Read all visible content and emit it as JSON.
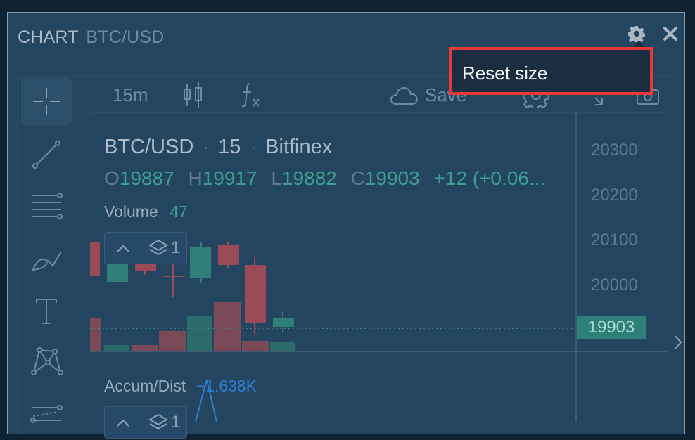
{
  "panel": {
    "title_main": "CHART",
    "title_symbol": "BTC/USD",
    "settings_icon": "gear-icon",
    "close_icon": "close-icon"
  },
  "top_toolbar": {
    "interval": "15m",
    "save_label": "Save"
  },
  "left_tools": [
    {
      "name": "crosshair-icon",
      "active": true
    },
    {
      "name": "trend-line-icon"
    },
    {
      "name": "fib-lines-icon"
    },
    {
      "name": "brush-icon"
    },
    {
      "name": "text-icon"
    },
    {
      "name": "pattern-icon"
    },
    {
      "name": "measure-icon"
    }
  ],
  "legend": {
    "symbol": "BTC/USD",
    "interval": "15",
    "exchange": "Bitfinex",
    "sep": "·",
    "o_key": "O",
    "o_val": "19887",
    "h_key": "H",
    "h_val": "19917",
    "l_key": "L",
    "l_val": "19882",
    "c_key": "C",
    "c_val": "19903",
    "change": "+12 (+0.06..."
  },
  "volume": {
    "name": "Volume",
    "value": "47",
    "layers": "1"
  },
  "accum": {
    "name": "Accum/Dist",
    "value": "−1.638K",
    "layers": "1"
  },
  "price_axis": {
    "labels": [
      "20300",
      "20200",
      "20100",
      "20000"
    ],
    "current": "19903"
  },
  "dropdown": {
    "item": "Reset size"
  },
  "colors": {
    "up": "#2e7f78",
    "down": "#9b4a58",
    "accent_red": "#e53935"
  }
}
